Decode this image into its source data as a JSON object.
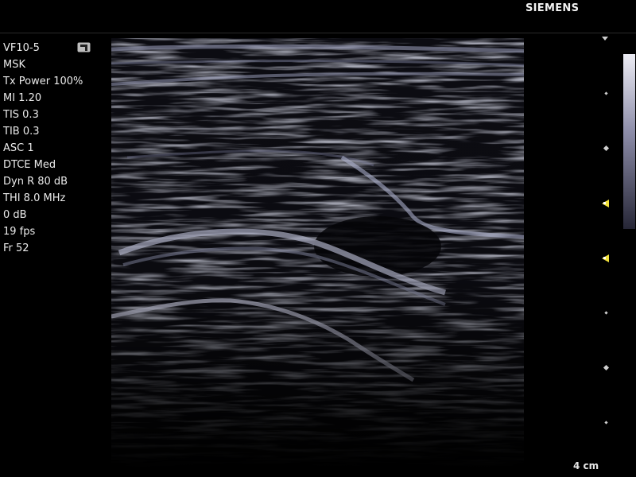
{
  "header": {
    "brand": "SIEMENS"
  },
  "parameters": [
    "VF10-5",
    "MSK",
    "Tx Power 100%",
    "MI 1.20",
    "TIS 0.3",
    "TIB 0.3",
    "ASC 1",
    "DTCE Med",
    "Dyn R 80 dB",
    "THI 8.0 MHz",
    "0 dB",
    "19 fps",
    "Fr 52"
  ],
  "depth_label": "4 cm",
  "icons": {
    "probe_orientation": "probe-orientation-icon",
    "focal_zone": "focal-zone-marker-icon",
    "depth_tick": "depth-tick-icon"
  },
  "colors": {
    "background": "#000000",
    "tissue_tint": "#b8bcd8",
    "focal_marker": "#f2e13a",
    "text": "#eaeaea"
  }
}
